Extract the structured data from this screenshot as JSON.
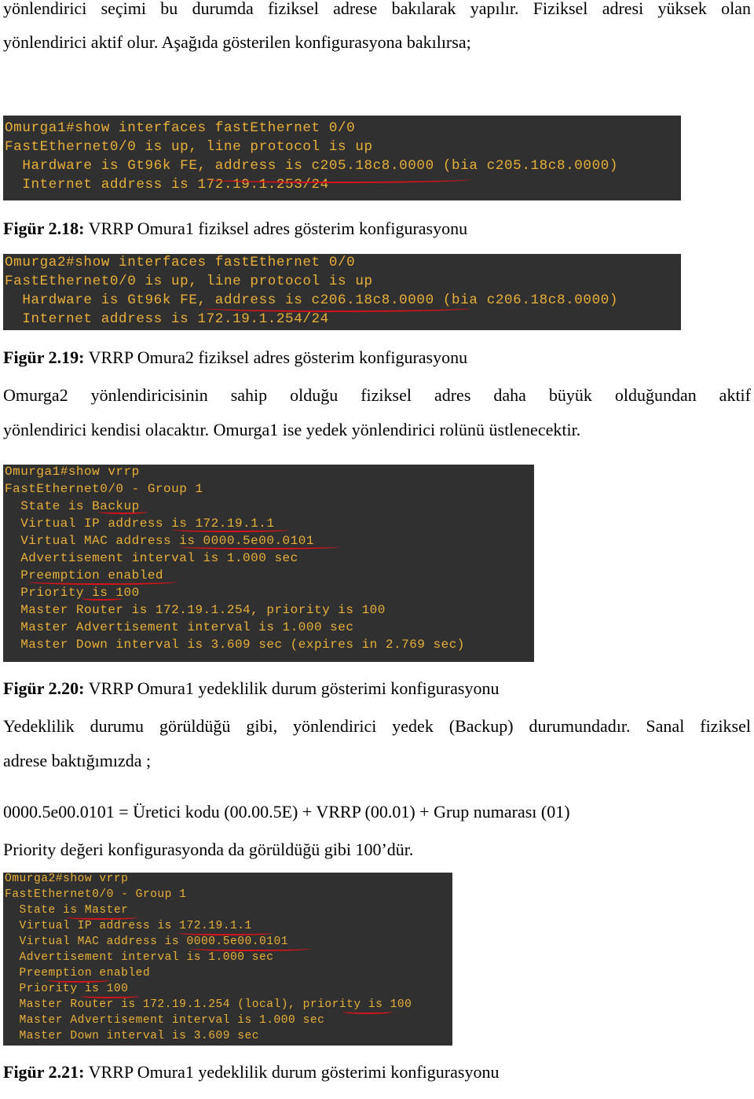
{
  "paragraphs": {
    "intro_line1": "yönlendirici seçimi bu durumda fiziksel adrese bakılarak yapılır. Fiziksel adresi yüksek olan",
    "intro_line2": "yönlendirici aktif olur. Aşağıda gösterilen konfigurasyona bakılırsa;",
    "omurga2_line1": "Omurga2 yönlendiricisinin sahip olduğu fiziksel adres daha büyük olduğundan aktif",
    "omurga2_line2": "yönlendirici kendisi olacaktır. Omurga1 ise yedek yönlendirici rolünü üstlenecektir.",
    "backup_line1": "Yedeklilik durumu görüldüğü gibi, yönlendirici yedek (Backup) durumundadır. Sanal fiziksel",
    "backup_line2": "adrese baktığımızda ;",
    "mac_formula": "0000.5e00.0101 = Üretici kodu (00.00.5E) + VRRP (00.01) + Grup numarası (01)",
    "priority_note": "Priority değeri konfigurasyonda da görüldüğü gibi 100’dür."
  },
  "figures": [
    {
      "label": "Figür 2.18:",
      "caption": "VRRP Omura1 fiziksel adres gösterim konfigurasyonu",
      "terminal_lines": [
        "Omurga1#show interfaces fastEthernet 0/0",
        "FastEthernet0/0 is up, line protocol is up",
        "  Hardware is Gt96k FE, address is c205.18c8.0000 (bia c205.18c8.0000)",
        "  Internet address is 172.19.1.253/24"
      ]
    },
    {
      "label": "Figür 2.19:",
      "caption": "VRRP Omura2 fiziksel adres gösterim konfigurasyonu",
      "terminal_lines": [
        "Omurga2#show interfaces fastEthernet 0/0",
        "FastEthernet0/0 is up, line protocol is up",
        "  Hardware is Gt96k FE, address is c206.18c8.0000 (bia c206.18c8.0000)",
        "  Internet address is 172.19.1.254/24"
      ]
    },
    {
      "label": "Figür 2.20:",
      "caption": "VRRP Omura1 yedeklilik durum gösterimi konfigurasyonu",
      "terminal_lines": [
        "Omurga1#show vrrp",
        "FastEthernet0/0 - Group 1",
        "  State is Backup",
        "  Virtual IP address is 172.19.1.1",
        "  Virtual MAC address is 0000.5e00.0101",
        "  Advertisement interval is 1.000 sec",
        "  Preemption enabled",
        "  Priority is 100",
        "  Master Router is 172.19.1.254, priority is 100",
        "  Master Advertisement interval is 1.000 sec",
        "  Master Down interval is 3.609 sec (expires in 2.769 sec)"
      ]
    },
    {
      "label": "Figür 2.21:",
      "caption": "VRRP Omura1 yedeklilik durum gösterimi konfigurasyonu",
      "terminal_lines": [
        "Omurga2#show vrrp",
        "FastEthernet0/0 - Group 1",
        "  State is Master",
        "  Virtual IP address is 172.19.1.1",
        "  Virtual MAC address is 0000.5e00.0101",
        "  Advertisement interval is 1.000 sec",
        "  Preemption enabled",
        "  Priority is 100",
        "  Master Router is 172.19.1.254 (local), priority is 100",
        "  Master Advertisement interval is 1.000 sec",
        "  Master Down interval is 3.609 sec"
      ]
    }
  ],
  "colors": {
    "terminal_bg": "#303030",
    "terminal_text": "#e8b03a",
    "annotation_underline": "#d4131b"
  }
}
